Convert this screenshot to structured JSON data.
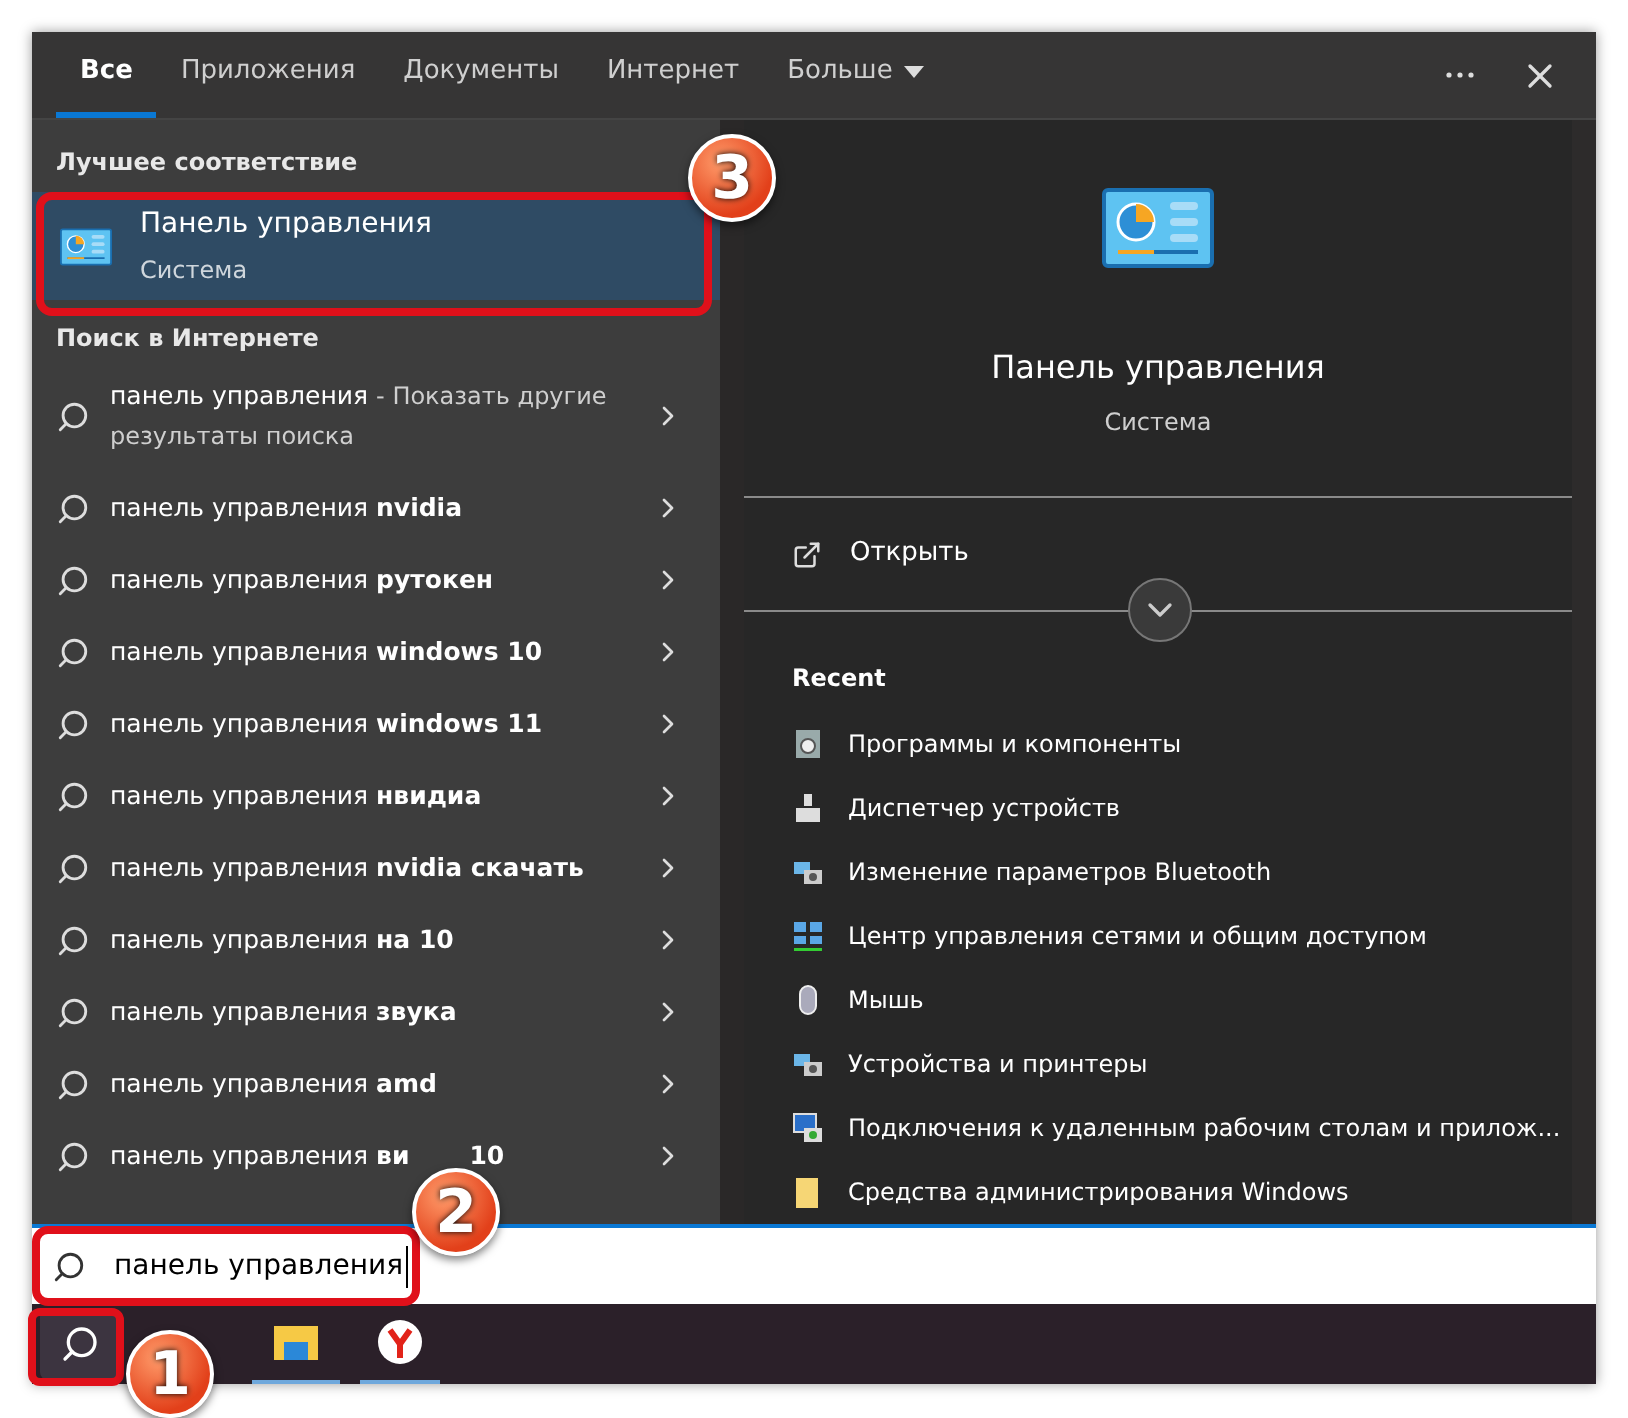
{
  "tabs": [
    {
      "label": "Все",
      "selected": true
    },
    {
      "label": "Приложения",
      "selected": false
    },
    {
      "label": "Документы",
      "selected": false
    },
    {
      "label": "Интернет",
      "selected": false
    },
    {
      "label": "Больше",
      "selected": false,
      "dropdown": true
    }
  ],
  "best_match": {
    "heading": "Лучшее соответствие",
    "title": "Панель управления",
    "subtitle": "Система",
    "selected": true
  },
  "web": {
    "heading": "Поиск в Интернете",
    "items": [
      {
        "text": "панель управления",
        "note": "- Показать другие результаты поиска"
      },
      {
        "text": "панель управления **nvidia**"
      },
      {
        "text": "панель управления **рутокен**"
      },
      {
        "text": "панель управления **windows 10**"
      },
      {
        "text": "панель управления **windows 11**"
      },
      {
        "text": "панель управления **нвидиа**"
      },
      {
        "text": "панель управления **nvidia скачать**"
      },
      {
        "text": "панель управления **на 10**"
      },
      {
        "text": "панель управления **звука**"
      },
      {
        "text": "панель управления **amd**"
      },
      {
        "text": "панель управления **ви**",
        "tail": "10"
      }
    ]
  },
  "preview": {
    "title": "Панель управления",
    "subtitle": "Система",
    "open": "Открыть",
    "recent_heading": "Recent",
    "recent": [
      "Программы и компоненты",
      "Диспетчер устройств",
      "Изменение параметров Bluetooth",
      "Центр управления сетями и общим доступом",
      "Мышь",
      "Устройства и принтеры",
      "Подключения к удаленным рабочим столам и прилож...",
      "Средства администрирования Windows"
    ]
  },
  "search": {
    "value": "панель управления"
  },
  "annotations": [
    "1",
    "2",
    "3"
  ]
}
